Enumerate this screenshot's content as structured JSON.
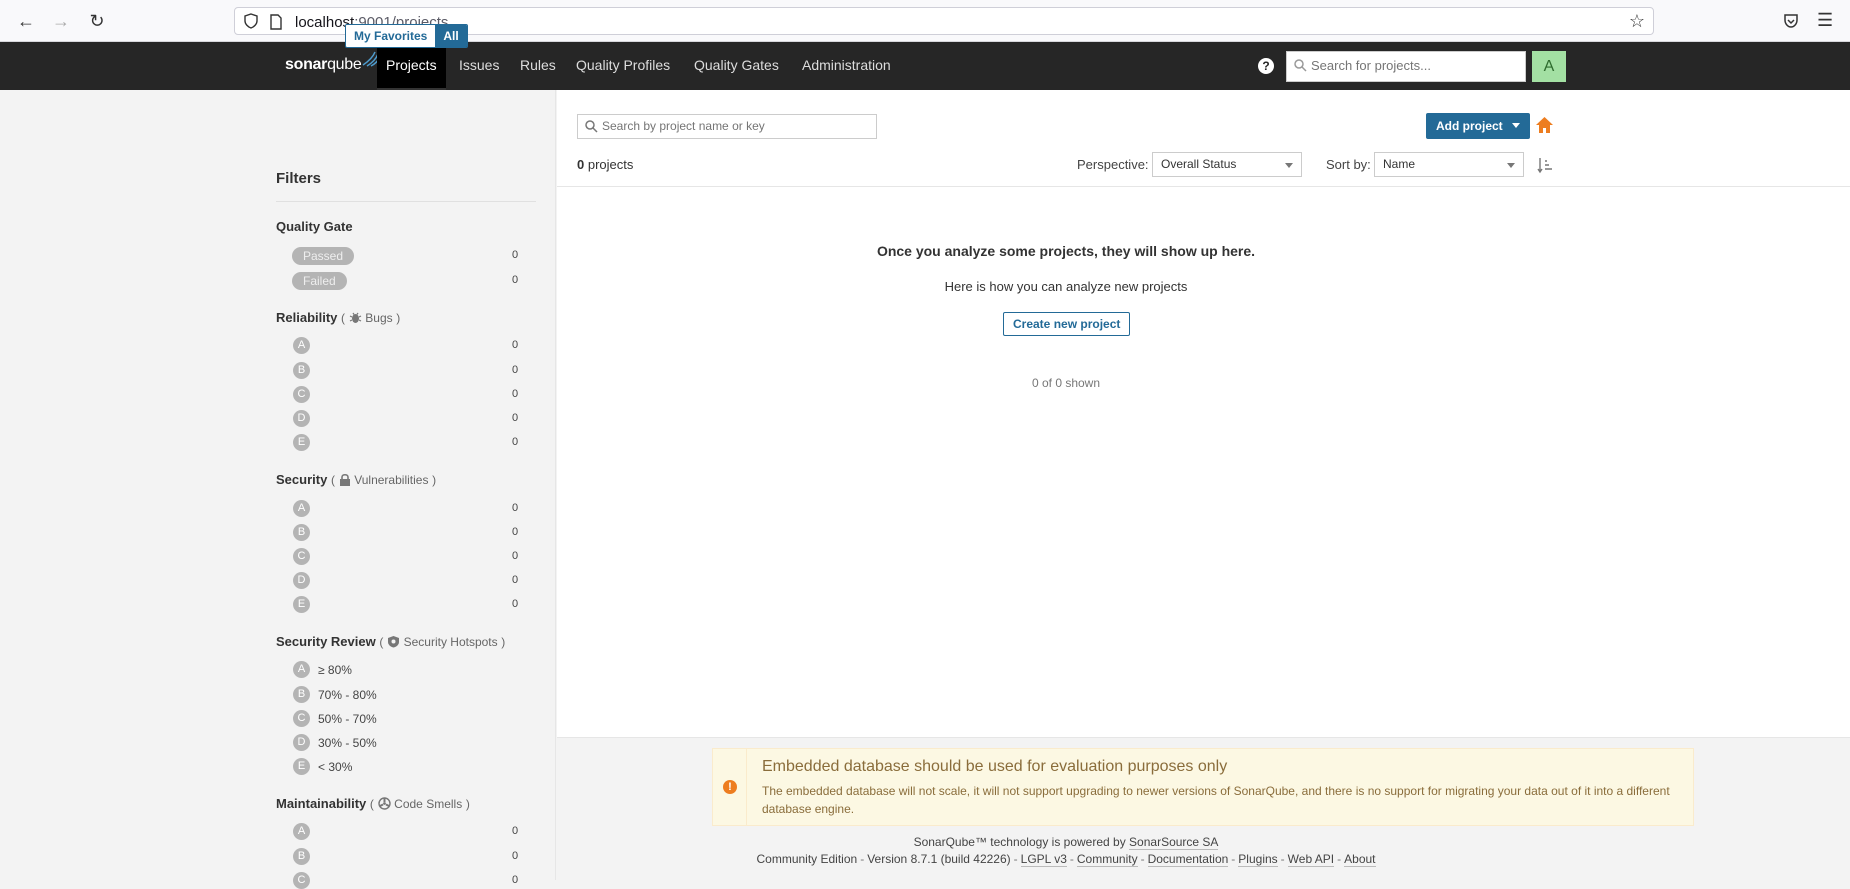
{
  "browser": {
    "url_host": "localhost",
    "url_path": ":9001/projects"
  },
  "nav": {
    "logo_bold": "sonar",
    "logo_thin": "qube",
    "items": [
      "Projects",
      "Issues",
      "Rules",
      "Quality Profiles",
      "Quality Gates",
      "Administration"
    ],
    "help": "?",
    "search_placeholder": "Search for projects...",
    "avatar_letter": "A"
  },
  "sidebar": {
    "my_favorites": "My Favorites",
    "all": "All",
    "filters_title": "Filters",
    "quality_gate": {
      "title": "Quality Gate",
      "passed": "Passed",
      "failed": "Failed",
      "passed_count": "0",
      "failed_count": "0"
    },
    "reliability": {
      "title": "Reliability",
      "sub_open": "(",
      "sub": "Bugs",
      "sub_close": ")"
    },
    "security": {
      "title": "Security",
      "sub_open": "(",
      "sub": "Vulnerabilities",
      "sub_close": ")"
    },
    "security_review": {
      "title": "Security Review",
      "sub_open": "(",
      "sub": "Security Hotspots",
      "sub_close": ")",
      "ranges": [
        "≥ 80%",
        "70% - 80%",
        "50% - 70%",
        "30% - 50%",
        "< 30%"
      ]
    },
    "maintainability": {
      "title": "Maintainability",
      "sub_open": "(",
      "sub": "Code Smells",
      "sub_close": ")"
    },
    "ratings": [
      "A",
      "B",
      "C",
      "D",
      "E"
    ],
    "zero": "0"
  },
  "main": {
    "search_placeholder": "Search by project name or key",
    "add_project": "Add project",
    "count_num": "0",
    "count_label": "projects",
    "perspective_label": "Perspective:",
    "perspective_value": "Overall Status",
    "sort_label": "Sort by:",
    "sort_value": "Name",
    "empty_title": "Once you analyze some projects, they will show up here.",
    "empty_sub": "Here is how you can analyze new projects",
    "create_btn": "Create new project",
    "shown": "0 of 0 shown"
  },
  "warning": {
    "icon": "!",
    "title": "Embedded database should be used for evaluation purposes only",
    "text": "The embedded database will not scale, it will not support upgrading to newer versions of SonarQube, and there is no support for migrating your data out of it into a different database engine."
  },
  "footer": {
    "powered": "SonarQube™ technology is powered by",
    "company": "SonarSource SA",
    "edition": "Community Edition",
    "version": "Version 8.7.1 (build 42226)",
    "license": "LGPL v3",
    "community": "Community",
    "documentation": "Documentation",
    "plugins": "Plugins",
    "webapi": "Web API",
    "about": "About",
    "dash": "-"
  },
  "colors": {
    "nav_bg": "#262626",
    "accent": "#236a97",
    "home_orange": "#ed7d20",
    "avatar_bg": "#a3e0a3"
  }
}
